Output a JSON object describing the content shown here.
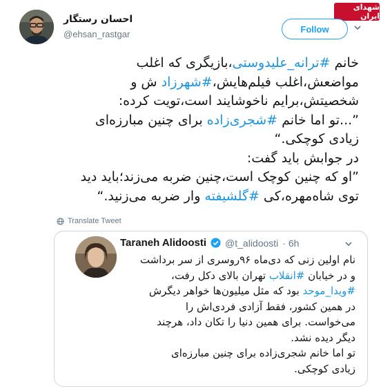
{
  "watermark": "شهدای ایران",
  "author": {
    "name": "احسان رستگار",
    "handle": "@ehsan_rastgar"
  },
  "follow_label": "Follow",
  "tweet_lines": [
    [
      {
        "t": "خانم "
      },
      {
        "t": "#ترانه_علیدوستی",
        "tag": true
      },
      {
        "t": "،بازیگری که اغلب"
      }
    ],
    [
      {
        "t": "مواضعش،اغلب فیلم‌هایش،"
      },
      {
        "t": "#شهرزاد",
        "tag": true
      },
      {
        "t": " ش و"
      }
    ],
    [
      {
        "t": "شخصیتش،برایم ناخوشایند است،تویت کرده:"
      }
    ],
    [
      {
        "t": "”...تو اما خانم "
      },
      {
        "t": "#شجری‌زاده",
        "tag": true
      },
      {
        "t": " برای چنین مبارزه‌ای"
      }
    ],
    [
      {
        "t": "زیادی کوچکی.“"
      }
    ],
    [
      {
        "t": "در جوابش باید گفت:"
      }
    ],
    [
      {
        "t": "”او که چنین کوچک است،چنین ضربه می‌زند؛باید دید"
      }
    ],
    [
      {
        "t": "توی شاه‌مهره،کی "
      },
      {
        "t": "#گلشیفته",
        "tag": true
      },
      {
        "t": " وار ضربه می‌زنید.“"
      }
    ]
  ],
  "translate_label": "Translate Tweet",
  "quote": {
    "name": "Taraneh Alidoosti",
    "handle": "@t_alidoosti",
    "time": "· 6h",
    "lines": [
      [
        {
          "t": "نام اولین زنی که دی‌ماه ۹۶روسری از سر برداشت"
        }
      ],
      [
        {
          "t": "و در خیابان "
        },
        {
          "t": "#انقلاب",
          "tag": true
        },
        {
          "t": " تهران بالای دکل رفت،"
        }
      ],
      [
        {
          "t": "#ویدا_موحد",
          "tag": true
        },
        {
          "t": " بود که مثل میلیون‌ها خواهر دیگرش"
        }
      ],
      [
        {
          "t": "در همین کشور، فقط آزادی فردی‌اش را"
        }
      ],
      [
        {
          "t": "می‌خواست. برای همین دنیا را تکان داد، هرچند"
        }
      ],
      [
        {
          "t": "دیگر دیده نشد."
        }
      ],
      [
        {
          "t": "تو اما خانم شجری‌زاده برای چنین مبارزه‌ای"
        }
      ],
      [
        {
          "t": "زیادی کوچکی."
        }
      ]
    ]
  },
  "colors": {
    "accent": "#1da1f2",
    "hashtag": "#1b95e0",
    "muted": "#657786",
    "border": "#ccd6dd"
  }
}
